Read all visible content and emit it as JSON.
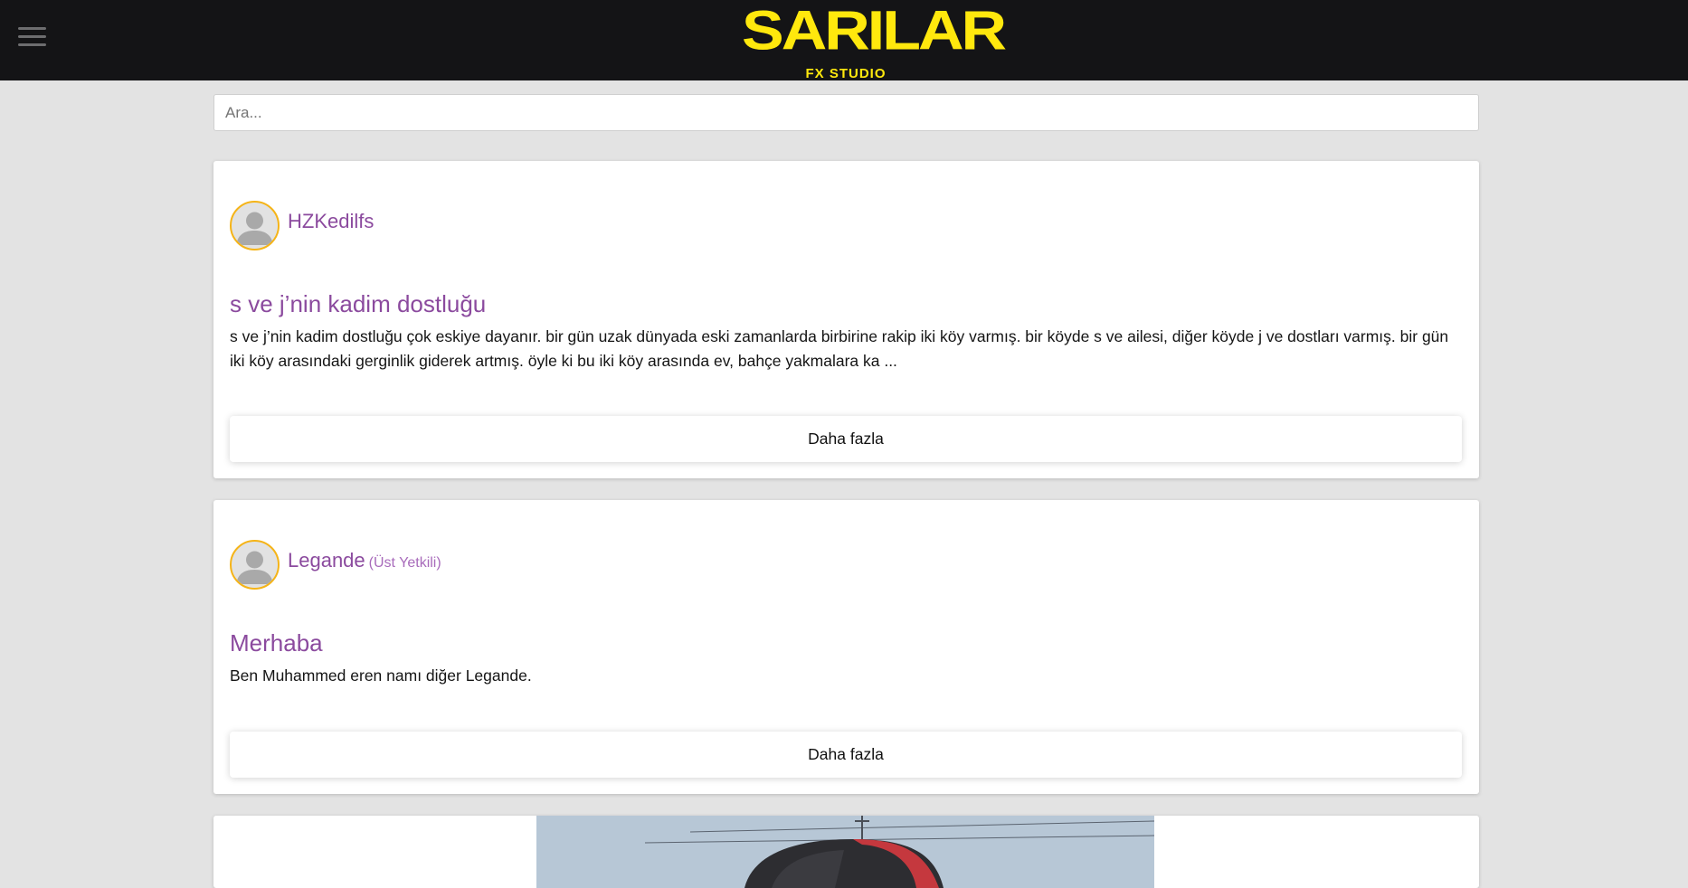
{
  "header": {
    "logo_main": "SARILAR",
    "logo_sub": "FX STUDIO",
    "menu_icon": "hamburger-menu-icon",
    "colors": {
      "bar": "#141416",
      "logo": "#ffe80d"
    }
  },
  "search": {
    "placeholder": "Ara...",
    "value": ""
  },
  "posts": [
    {
      "author": "HZKedilfs",
      "role": "",
      "title": "s ve j’nin kadim dostluğu",
      "body": "s ve j’nin kadim dostluğu çok eskiye dayanır. bir gün uzak dünyada eski zamanlarda birbirine rakip iki köy varmış. bir köyde s ve ailesi, diğer köyde j ve dostları varmış. bir gün iki köy arasındaki gerginlik giderek artmış. öyle ki bu iki köy arasında ev, bahçe yakmalara ka ...",
      "more_label": "Daha fazla"
    },
    {
      "author": "Legande",
      "role": "(Üst Yetkili)",
      "title": "Merhaba",
      "body": "Ben Muhammed eren namı diğer Legande.",
      "more_label": "Daha fazla"
    }
  ],
  "theme": {
    "accent": "#8b4a9e",
    "avatar_ring": "#f5b418",
    "background": "#e3e3e3"
  }
}
